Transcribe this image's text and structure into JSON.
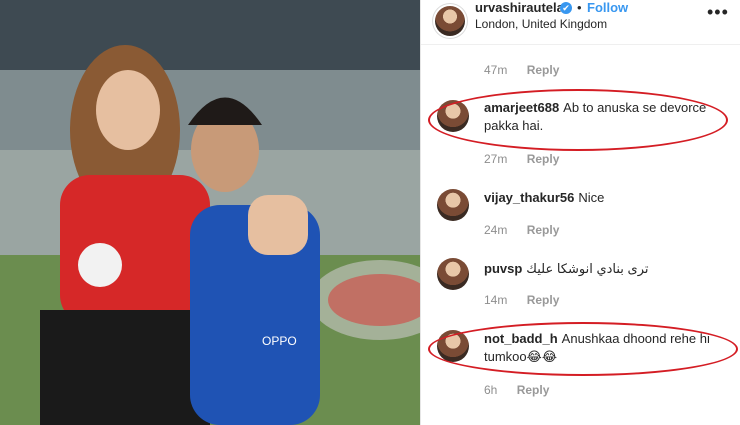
{
  "post": {
    "username": "urvashirautela",
    "verified_mark": "✔",
    "separator": "•",
    "follow_label": "Follow",
    "location": "London, United Kingdom",
    "more_label": "•••"
  },
  "top_meta": {
    "time": "47m",
    "reply": "Reply"
  },
  "comments": [
    {
      "username": "amarjeet688",
      "text": "Ab to anuska se devorce pakka hai.",
      "time": "27m",
      "reply": "Reply",
      "highlighted": true
    },
    {
      "username": "vijay_thakur56",
      "text": "Nice",
      "time": "24m",
      "reply": "Reply",
      "highlighted": false
    },
    {
      "username": "puvsp",
      "text": "ترى بنادي انوشكا عليك",
      "time": "14m",
      "reply": "Reply",
      "highlighted": false
    },
    {
      "username": "not_badd_h",
      "text": "Anushkaa dhoond rehe hi tumkoo😂😂",
      "time": "6h",
      "reply": "Reply",
      "highlighted": true
    }
  ],
  "photo": {
    "jersey_brand": "OPPO"
  },
  "colors": {
    "link": "#3897f0",
    "highlight_ring": "#d41d24",
    "muted": "#8e8e8e"
  },
  "icons": [
    "verified-badge-icon",
    "more-options-icon"
  ]
}
